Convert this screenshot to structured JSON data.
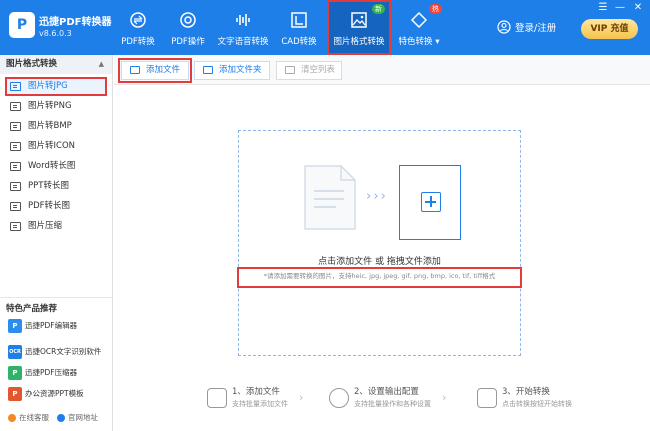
{
  "header": {
    "logo_char": "P",
    "app_name": "迅捷PDF转换器",
    "version": "v8.6.0.3",
    "nav": [
      {
        "label": "PDF转换",
        "icon": "pdf-convert-icon"
      },
      {
        "label": "PDF操作",
        "icon": "pdf-operation-icon"
      },
      {
        "label": "文字语音转换",
        "icon": "text-voice-icon"
      },
      {
        "label": "CAD转换",
        "icon": "cad-convert-icon"
      },
      {
        "label": "图片格式转换",
        "icon": "image-convert-icon",
        "badge": "新"
      },
      {
        "label": "特色转换 ▾",
        "icon": "special-convert-icon",
        "badge": "热"
      }
    ],
    "login_label": "登录/注册",
    "vip_label": "VIP 充值",
    "win_controls": [
      "☰",
      "—",
      "✕"
    ]
  },
  "sidebar": {
    "section_title": "图片格式转换",
    "items": [
      {
        "label": "图片转JPG",
        "active": true
      },
      {
        "label": "图片转PNG"
      },
      {
        "label": "图片转BMP"
      },
      {
        "label": "图片转ICON"
      },
      {
        "label": "Word转长图"
      },
      {
        "label": "PPT转长图"
      },
      {
        "label": "PDF转长图"
      },
      {
        "label": "图片压缩"
      }
    ],
    "products_title": "特色产品推荐",
    "products": [
      {
        "label": "迅捷PDF编辑器",
        "icon_char": "P",
        "color": "#2d8cf0"
      },
      {
        "label": "迅捷OCR文字识别软件",
        "icon_char": "OCR",
        "color": "#1f7fe8"
      },
      {
        "label": "迅捷PDF压缩器",
        "icon_char": "P",
        "color": "#2db36a"
      },
      {
        "label": "办公资源PPT模板",
        "icon_char": "P",
        "color": "#e4572e"
      }
    ],
    "footer": {
      "online_service": "在线客服",
      "website": "官网地址"
    }
  },
  "toolbar": {
    "add_file": "添加文件",
    "add_folder": "添加文件夹",
    "clear_list": "清空列表"
  },
  "dropzone": {
    "arrows": "› › ›",
    "title": "点击添加文件 或 拖拽文件添加",
    "hint": "*请添加需要转换的图片，支持heic, jpg, jpeg, gif, png, bmp, ico, tif, tiff格式"
  },
  "steps": [
    {
      "title": "1、添加文件",
      "sub": "支持批量添加文件"
    },
    {
      "title": "2、设置输出配置",
      "sub": "支持批量操作和各种设置"
    },
    {
      "title": "3、开始转换",
      "sub": "点击转换按钮开始转换"
    }
  ],
  "colors": {
    "brand": "#1f7fe8",
    "highlight": "#e23b3b"
  }
}
